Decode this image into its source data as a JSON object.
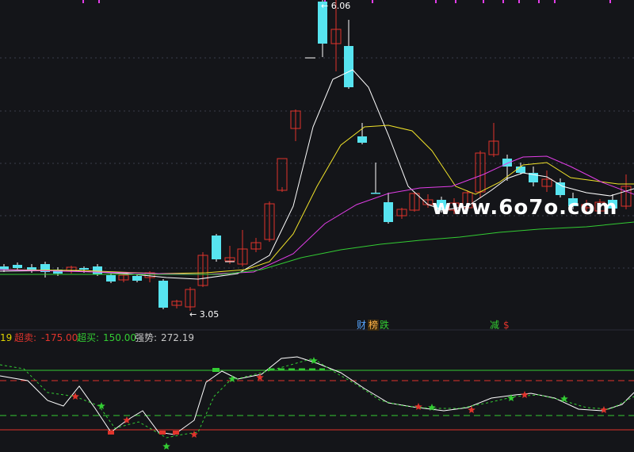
{
  "price_labels": {
    "high": "6.06",
    "low": "3.05"
  },
  "event_badges": [
    "财",
    "榜",
    "跌",
    "减",
    "$"
  ],
  "indicator": {
    "index_frag": "19",
    "oversold_label": "超卖:",
    "oversold_value": "-175.00",
    "overbought_label": "超买:",
    "overbought_value": "150.00",
    "strength_label": "强势:",
    "strength_value": "272.19"
  },
  "watermark": "www.6o7o.com",
  "colors": {
    "up": "#e0342c",
    "down": "#57e4f0",
    "ma_fast": "#ffffff",
    "ma_mid": "#f0e22a",
    "ma_slow": "#e23ee8",
    "ma_long": "#33cc33",
    "grid": "#3a3d4a",
    "background": "#141519"
  }
}
